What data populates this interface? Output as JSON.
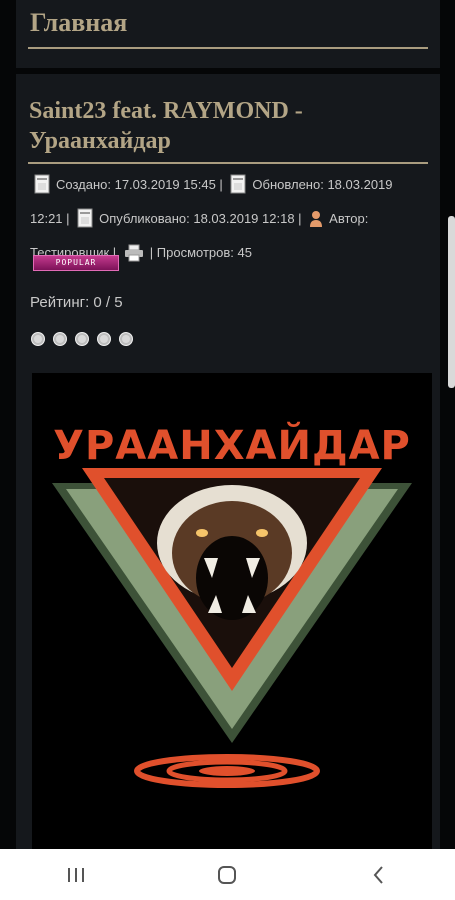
{
  "header": {
    "title": "Главная"
  },
  "article": {
    "title": "Saint23 feat. RAYMOND - Ураанхайдар",
    "created_label": "Создано: 17.03.2019 15:45 |",
    "updated_label": "Обновлено: 18.03.2019 12:21 |",
    "published_label": "Опубликовано: 18.03.2019 12:18 |",
    "author_label": "Автор: Тестировщик |",
    "views_label": "| Просмотров: 45",
    "badge": "POPULAR",
    "rating_label": "Рейтинг:",
    "rating_value": "0 / 5",
    "rating_stars_filled": 0,
    "rating_stars_total": 5,
    "artwork_text": "УРААНХАЙДАР"
  },
  "colors": {
    "title": "#b3a586",
    "panel": "#15181c",
    "accent": "#e0502c"
  },
  "icons": [
    "calendar-icon",
    "user-icon",
    "print-icon",
    "recent-apps-icon",
    "home-icon",
    "back-icon"
  ]
}
